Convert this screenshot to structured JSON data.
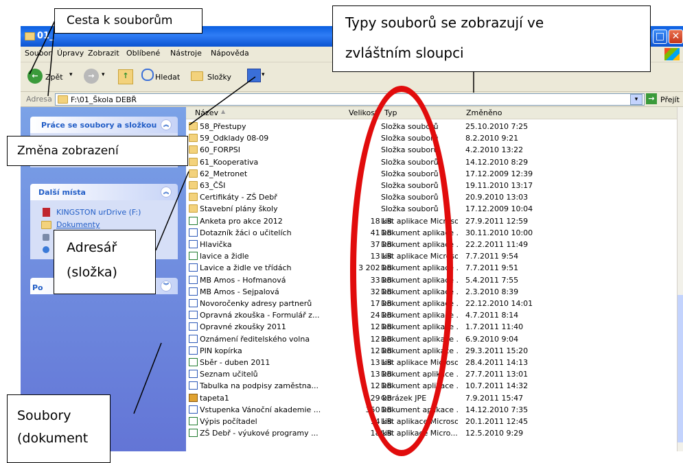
{
  "window": {
    "title": "01_",
    "menu": [
      "Soubor",
      "Úpravy",
      "Zobrazit",
      "Oblíbené",
      "Nástroje",
      "Nápověda"
    ]
  },
  "toolbar": {
    "back_label": "Zpět",
    "search_label": "Hledat",
    "folders_label": "Složky"
  },
  "address": {
    "label": "Adresa",
    "path": "F:\\01_Škola DEBŘ",
    "go_label": "Přejít"
  },
  "left_pane": {
    "tasks_title": "Práce se soubory a složkou",
    "places_title": "Další místa",
    "places": [
      "KINGSTON urDrive (F:)",
      "Dokumenty"
    ],
    "details_title": "Po"
  },
  "columns": {
    "name": "Název",
    "size": "Velikost",
    "type": "Typ",
    "date": "Změněno"
  },
  "files": [
    {
      "name": "58_Přestupy",
      "size": "",
      "type": "Složka souborů",
      "date": "25.10.2010 7:25",
      "icon": "folder"
    },
    {
      "name": "59_Odklady 08-09",
      "size": "",
      "type": "Složka souborů",
      "date": "8.2.2010 9:21",
      "icon": "folder"
    },
    {
      "name": "60_FORPSI",
      "size": "",
      "type": "Složka souborů",
      "date": "4.2.2010 13:22",
      "icon": "folder"
    },
    {
      "name": "61_Kooperativa",
      "size": "",
      "type": "Složka souborů",
      "date": "14.12.2010 8:29",
      "icon": "folder"
    },
    {
      "name": "62_Metronet",
      "size": "",
      "type": "Složka souborů",
      "date": "17.12.2009 12:39",
      "icon": "folder"
    },
    {
      "name": "63_ČŠI",
      "size": "",
      "type": "Složka souborů",
      "date": "19.11.2010 13:17",
      "icon": "folder"
    },
    {
      "name": "Certifikáty - ZŠ Debř",
      "size": "",
      "type": "Složka souborů",
      "date": "20.9.2010 13:03",
      "icon": "folder"
    },
    {
      "name": "Stavební plány školy",
      "size": "",
      "type": "Složka souborů",
      "date": "17.12.2009 10:04",
      "icon": "folder"
    },
    {
      "name": "Anketa pro akce 2012",
      "size": "18 kB",
      "type": "List aplikace Microso...",
      "date": "27.9.2011 12:59",
      "icon": "xls"
    },
    {
      "name": "Dotazník žáci o učitelích",
      "size": "41 kB",
      "type": "Dokument aplikace ...",
      "date": "30.11.2010 10:00",
      "icon": "doc"
    },
    {
      "name": "Hlavička",
      "size": "37 kB",
      "type": "Dokument aplikace ...",
      "date": "22.2.2011 11:49",
      "icon": "doc"
    },
    {
      "name": "lavice a židle",
      "size": "13 kB",
      "type": "List aplikace Microso...",
      "date": "7.7.2011 9:54",
      "icon": "xls"
    },
    {
      "name": "Lavice a židle ve třídách",
      "size": "3 202 kB",
      "type": "Dokument aplikace ...",
      "date": "7.7.2011 9:51",
      "icon": "doc"
    },
    {
      "name": "MB Amos - Hofmanová",
      "size": "33 kB",
      "type": "Dokument aplikace ...",
      "date": "5.4.2011 7:55",
      "icon": "doc"
    },
    {
      "name": "MB Amos - Sejpalová",
      "size": "32 kB",
      "type": "Dokument aplikace ...",
      "date": "2.3.2010 8:39",
      "icon": "doc"
    },
    {
      "name": "Novoročenky adresy partnerů",
      "size": "17 kB",
      "type": "Dokument aplikace ...",
      "date": "22.12.2010 14:01",
      "icon": "doc"
    },
    {
      "name": "Opravná zkouška - Formulář z...",
      "size": "24 kB",
      "type": "Dokument aplikace ...",
      "date": "4.7.2011 8:14",
      "icon": "doc"
    },
    {
      "name": "Opravné zkoušky 2011",
      "size": "12 kB",
      "type": "Dokument aplikace ...",
      "date": "1.7.2011 11:40",
      "icon": "doc"
    },
    {
      "name": "Oznámení ředitelského volna",
      "size": "12 kB",
      "type": "Dokument aplikace ...",
      "date": "6.9.2010 9:04",
      "icon": "doc"
    },
    {
      "name": "PIN kopírka",
      "size": "12 kB",
      "type": "Dokument aplikace ...",
      "date": "29.3.2011 15:20",
      "icon": "doc"
    },
    {
      "name": "Sběr - duben 2011",
      "size": "13 kB",
      "type": "List aplikace Microso...",
      "date": "28.4.2011 14:13",
      "icon": "xls"
    },
    {
      "name": "Seznam učitelů",
      "size": "13 kB",
      "type": "Dokument aplikace ...",
      "date": "27.7.2011 13:01",
      "icon": "doc"
    },
    {
      "name": "Tabulka na podpisy zaměstna...",
      "size": "12 kB",
      "type": "Dokument aplikace ...",
      "date": "10.7.2011 14:32",
      "icon": "doc"
    },
    {
      "name": "tapeta1",
      "size": "29 kB",
      "type": "Obrázek JPE",
      "date": "7.9.2011 15:47",
      "icon": "jpg"
    },
    {
      "name": "Vstupenka Vánoční akademie ...",
      "size": "350 kB",
      "type": "Dokument aplikace ...",
      "date": "14.12.2010 7:35",
      "icon": "doc"
    },
    {
      "name": "Výpis počítadel",
      "size": "14 kB",
      "type": "List aplikace Microso...",
      "date": "20.1.2011 12:45",
      "icon": "xls"
    },
    {
      "name": "ZŠ Debř - výukové programy ...",
      "size": "18 kB",
      "type": "List aplikace Micro...",
      "date": "12.5.2010 9:29",
      "icon": "xls"
    }
  ],
  "annotations": {
    "path": "Cesta k souborům",
    "types_line1": "Typy souborů se zobrazují ve",
    "types_line2": "zvláštním sloupci",
    "view": "Změna zobrazení",
    "folder_line1": "Adresář",
    "folder_line2": "(složka)",
    "files_line1": "Soubory",
    "files_line2": "(dokument"
  },
  "colors": {
    "ellipse": "#e10c0c",
    "titlebar": "#0a5fe0",
    "taskpane": "#6f8fe0"
  }
}
